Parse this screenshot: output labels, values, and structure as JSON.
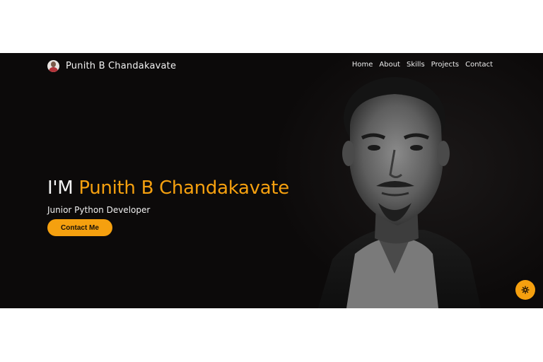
{
  "nav": {
    "brand_name": "Punith B Chandakavate",
    "links": [
      "Home",
      "About",
      "Skills",
      "Projects",
      "Contact"
    ]
  },
  "hero": {
    "title_prefix": "I'M ",
    "title_name": "Punith B Chandakavate",
    "subtitle": "Junior Python Developer",
    "cta_label": "Contact Me"
  },
  "colors": {
    "accent": "#f5a00f",
    "background": "#0c0a0a",
    "text": "#f2f2f2"
  },
  "icons": {
    "settings": "gear-icon"
  }
}
